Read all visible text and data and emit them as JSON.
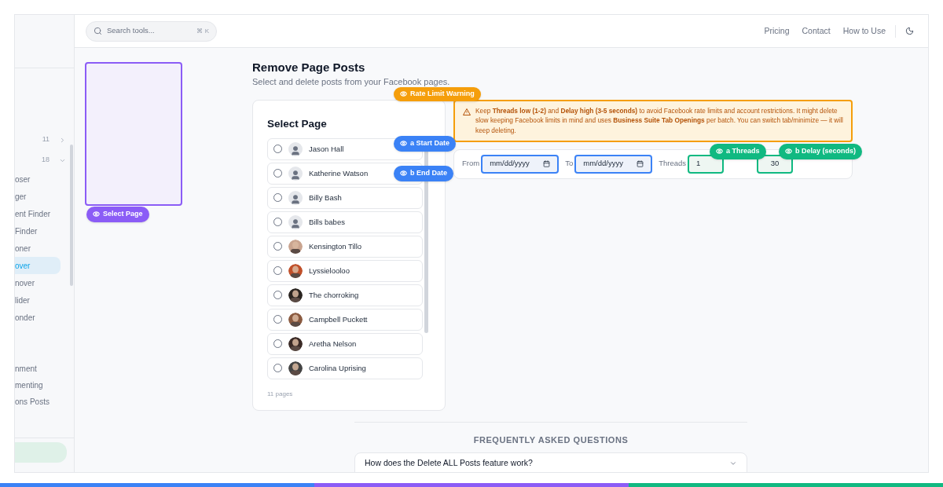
{
  "sidebar": {
    "groups": [
      {
        "count": "11",
        "expanded": false
      },
      {
        "count": "18",
        "expanded": true
      }
    ],
    "items": [
      {
        "label": "oser",
        "selected": false
      },
      {
        "label": "ger",
        "selected": false
      },
      {
        "label": "ent Finder",
        "selected": false
      },
      {
        "label": "Finder",
        "selected": false
      },
      {
        "label": "oner",
        "selected": false
      },
      {
        "label": "over",
        "selected": true
      },
      {
        "label": "nover",
        "selected": false
      },
      {
        "label": "lider",
        "selected": false
      },
      {
        "label": "onder",
        "selected": false
      }
    ],
    "items_2": [
      {
        "label": "nment",
        "selected": false
      },
      {
        "label": "menting",
        "selected": false
      },
      {
        "label": "ons Posts",
        "selected": false
      }
    ]
  },
  "header": {
    "search": {
      "placeholder": "Search tools...",
      "shortcut": "⌘ K"
    },
    "links": [
      "Pricing",
      "Contact",
      "How to Use"
    ]
  },
  "tour": {
    "select_page": "Select Page",
    "rate_limit": "Rate Limit Warning",
    "start_date": "a Start Date",
    "end_date": "b End Date",
    "threads": "a Threads",
    "delay": "b Delay (seconds)"
  },
  "title": "Remove Page Posts",
  "subtitle": "Select and delete posts from your Facebook pages.",
  "select_page": {
    "title": "Select Page",
    "footer": "11 pages",
    "pages": [
      {
        "name": "Jason Hall",
        "kind": "placeholder",
        "selected": false
      },
      {
        "name": "Katherine Watson",
        "kind": "placeholder",
        "selected": false
      },
      {
        "name": "Billy Bash",
        "kind": "placeholder",
        "selected": false
      },
      {
        "name": "Bills babes",
        "kind": "placeholder",
        "selected": false
      },
      {
        "name": "Kensington Tillo",
        "color": "#c9a48f",
        "selected": false
      },
      {
        "name": "Lyssielooloo",
        "color": "#c0502a",
        "selected": false
      },
      {
        "name": "The chorroking",
        "color": "#2a2420",
        "selected": false
      },
      {
        "name": "Campbell Puckett",
        "color": "#8a5a40",
        "selected": false
      },
      {
        "name": "Aretha Nelson",
        "color": "#3a2a26",
        "selected": false
      },
      {
        "name": "Carolina Uprising",
        "color": "#444444",
        "selected": false
      }
    ]
  },
  "warning": "Keep **Threads low (1-2)** and **Delay high (3-5 seconds)** to avoid Facebook rate limits and account restrictions. It might delete slow keeping Facebook limits in mind and uses **Business Suite Tab Openings** per batch. You can switch tab/minimize — it will keep deleting.",
  "filters": {
    "from_label": "From",
    "from_placeholder": "mm/dd/yyyy",
    "to_label": "To",
    "to_placeholder": "mm/dd/yyyy",
    "threads_label": "Threads",
    "threads_value": "1",
    "delay_value": "30"
  },
  "faq": {
    "title": "FREQUENTLY ASKED QUESTIONS",
    "items": [
      {
        "question": "How does the Delete ALL Posts feature work?",
        "expanded": false
      }
    ]
  }
}
